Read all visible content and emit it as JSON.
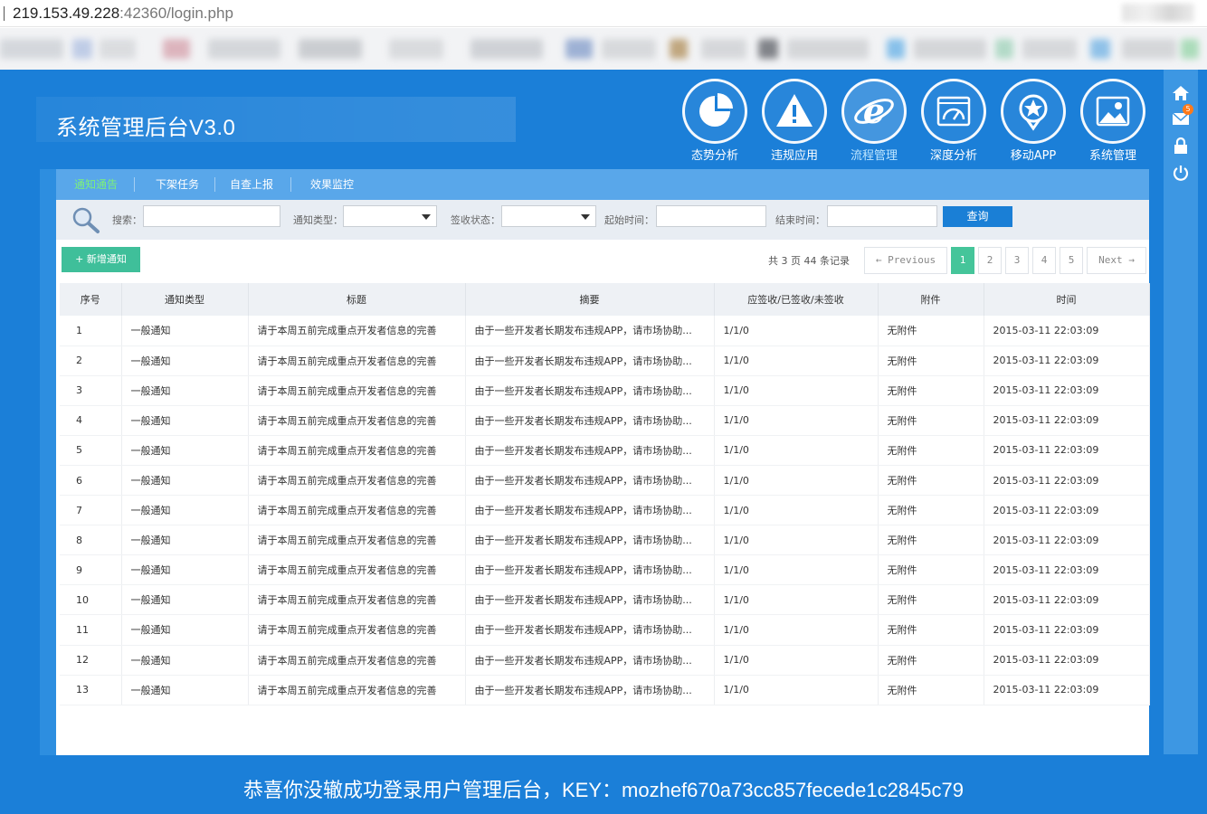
{
  "browser": {
    "url_host": "219.153.49.228",
    "url_port_path": ":42360/login.php"
  },
  "app": {
    "title": "系统管理后台V3.0",
    "colors": {
      "primary": "#1b7fd8",
      "accent_green": "#45c59a",
      "active_tab": "#7df07a"
    }
  },
  "topnav": [
    {
      "label": "态势分析",
      "icon": "pie-chart-icon"
    },
    {
      "label": "违规应用",
      "icon": "warning-icon"
    },
    {
      "label": "流程管理",
      "icon": "ie-browser-icon",
      "active": true
    },
    {
      "label": "深度分析",
      "icon": "speedometer-icon"
    },
    {
      "label": "移动APP",
      "icon": "star-badge-icon"
    },
    {
      "label": "系统管理",
      "icon": "settings-image-icon"
    }
  ],
  "rail": {
    "icons": [
      "home-icon",
      "mail-icon",
      "lock-icon",
      "power-icon"
    ],
    "mail_badge": "5"
  },
  "subtabs": [
    "通知通告",
    "下架任务",
    "自查上报",
    "效果监控"
  ],
  "search": {
    "search_label": "搜索：",
    "type_label": "通知类型：",
    "sign_label": "签收状态：",
    "start_label": "起始时间：",
    "end_label": "结束时间：",
    "query_button": "查询"
  },
  "toolbar": {
    "add_button": "新增通知",
    "pager_info": "共 3 页 44 条记录",
    "prev": "← Previous",
    "pages": [
      "1",
      "2",
      "3",
      "4",
      "5"
    ],
    "next": "Next →",
    "current_page": "1"
  },
  "table": {
    "headers": [
      "序号",
      "通知类型",
      "标题",
      "摘要",
      "应签收/已签收/未签收",
      "附件",
      "时间"
    ],
    "rows": [
      [
        "1",
        "一般通知",
        "请于本周五前完成重点开发者信息的完善",
        "由于一些开发者长期发布违规APP，请市场协助...",
        "1/1/0",
        "无附件",
        "2015-03-11 22:03:09"
      ],
      [
        "2",
        "一般通知",
        "请于本周五前完成重点开发者信息的完善",
        "由于一些开发者长期发布违规APP，请市场协助...",
        "1/1/0",
        "无附件",
        "2015-03-11 22:03:09"
      ],
      [
        "3",
        "一般通知",
        "请于本周五前完成重点开发者信息的完善",
        "由于一些开发者长期发布违规APP，请市场协助...",
        "1/1/0",
        "无附件",
        "2015-03-11 22:03:09"
      ],
      [
        "4",
        "一般通知",
        "请于本周五前完成重点开发者信息的完善",
        "由于一些开发者长期发布违规APP，请市场协助...",
        "1/1/0",
        "无附件",
        "2015-03-11 22:03:09"
      ],
      [
        "5",
        "一般通知",
        "请于本周五前完成重点开发者信息的完善",
        "由于一些开发者长期发布违规APP，请市场协助...",
        "1/1/0",
        "无附件",
        "2015-03-11 22:03:09"
      ],
      [
        "6",
        "一般通知",
        "请于本周五前完成重点开发者信息的完善",
        "由于一些开发者长期发布违规APP，请市场协助...",
        "1/1/0",
        "无附件",
        "2015-03-11 22:03:09"
      ],
      [
        "7",
        "一般通知",
        "请于本周五前完成重点开发者信息的完善",
        "由于一些开发者长期发布违规APP，请市场协助...",
        "1/1/0",
        "无附件",
        "2015-03-11 22:03:09"
      ],
      [
        "8",
        "一般通知",
        "请于本周五前完成重点开发者信息的完善",
        "由于一些开发者长期发布违规APP，请市场协助...",
        "1/1/0",
        "无附件",
        "2015-03-11 22:03:09"
      ],
      [
        "9",
        "一般通知",
        "请于本周五前完成重点开发者信息的完善",
        "由于一些开发者长期发布违规APP，请市场协助...",
        "1/1/0",
        "无附件",
        "2015-03-11 22:03:09"
      ],
      [
        "10",
        "一般通知",
        "请于本周五前完成重点开发者信息的完善",
        "由于一些开发者长期发布违规APP，请市场协助...",
        "1/1/0",
        "无附件",
        "2015-03-11 22:03:09"
      ],
      [
        "11",
        "一般通知",
        "请于本周五前完成重点开发者信息的完善",
        "由于一些开发者长期发布违规APP，请市场协助...",
        "1/1/0",
        "无附件",
        "2015-03-11 22:03:09"
      ],
      [
        "12",
        "一般通知",
        "请于本周五前完成重点开发者信息的完善",
        "由于一些开发者长期发布违规APP，请市场协助...",
        "1/1/0",
        "无附件",
        "2015-03-11 22:03:09"
      ],
      [
        "13",
        "一般通知",
        "请于本周五前完成重点开发者信息的完善",
        "由于一些开发者长期发布违规APP，请市场协助...",
        "1/1/0",
        "无附件",
        "2015-03-11 22:03:09"
      ]
    ]
  },
  "footer": {
    "message": "恭喜你没辙成功登录用户管理后台，KEY：mozhef670a73cc857fecede1c2845c79"
  }
}
